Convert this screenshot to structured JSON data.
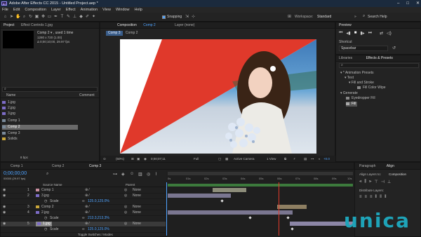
{
  "app": {
    "title": "Adobe After Effects CC 2015 - Untitled Project.aep *",
    "icon_label": "Ae",
    "win_buttons": [
      "–",
      "□",
      "✕"
    ]
  },
  "menu": [
    "File",
    "Edit",
    "Composition",
    "Layer",
    "Effect",
    "Animation",
    "View",
    "Window",
    "Help"
  ],
  "toolbar": {
    "snapping": "Snapping",
    "workspace_label": "Workspace:",
    "workspace_value": "Standard",
    "search_placeholder": "Search Help"
  },
  "project": {
    "tab": "Project",
    "effect_tab": "Effect Controls 1.jpg",
    "comp_name": "Comp 2 ▾ , used 1 time",
    "comp_size": "1280 x 720 (1.00)",
    "comp_dur": "Δ 0;00;10;00, 29.97 fps",
    "search_placeholder": "⌕",
    "col_name": "Name",
    "col_comment": "Comment",
    "items": [
      "1.jpg",
      "2.jpg",
      "3.jpg",
      "Comp 1",
      "Comp 2",
      "Comp 3",
      "Solids"
    ],
    "footer": "8 bpc"
  },
  "composition": {
    "tab": "Composition",
    "tab_comp": "Comp 2",
    "breadcrumb": [
      "Comp 3",
      "Comp 2"
    ],
    "layer_tab": "Layer (none)",
    "zoom": "(50%)",
    "timecode": "0;00;07;11",
    "res": "Full",
    "camera": "Active Camera",
    "view": "1 View",
    "exposure": "+0.0"
  },
  "preview": {
    "tab": "Preview",
    "shortcut_label": "Shortcut",
    "shortcut_value": "Spacebar"
  },
  "effects": {
    "tab_libraries": "Libraries",
    "tab_effects": "Effects & Presets",
    "search": "⌕",
    "tree": [
      "▾ * Animation Presets",
      "▾ Text",
      "▾ Fill and Stroke",
      "Fill Color Wipe",
      "▾ Generate",
      "Eyedropper Fill",
      "Fill"
    ]
  },
  "timeline": {
    "tabs": [
      "Comp 1",
      "Comp 2",
      "Comp 3"
    ],
    "timecode": "0;00;00;00",
    "fps": "00000 (29.97 fps)",
    "col_source": "Source Name",
    "col_parent": "Parent",
    "ruler": [
      "0s",
      "01s",
      "02s",
      "03s",
      "04s",
      "05s",
      "06s",
      "07s",
      "08s",
      "09s",
      "10s"
    ],
    "layers": [
      {
        "num": "1",
        "name": "Comp 1",
        "parent": "None"
      },
      {
        "num": "2",
        "name": "3.jpg",
        "parent": "None",
        "prop": "Scale",
        "prop_val": "125.0,125.0%"
      },
      {
        "num": "3",
        "name": "Comp 2",
        "parent": "None"
      },
      {
        "num": "4",
        "name": "2.jpg",
        "parent": "None",
        "prop": "Scale",
        "prop_val": "213.3,213.3%"
      },
      {
        "num": "5",
        "name": "1.jpg",
        "parent": "None",
        "prop": "Scale",
        "prop_val": "125.0,125.0%"
      }
    ],
    "footer": "Toggle Switches / Modes"
  },
  "paragraph": {
    "tab": "Paragraph",
    "align_tab": "Align",
    "align_to_label": "Align Layers to:",
    "align_to_value": "Composition",
    "distribute_label": "Distribute Layers:"
  },
  "watermark": "unica",
  "colors": {
    "accent": "#4ea3ff",
    "red": "#e0392b"
  }
}
